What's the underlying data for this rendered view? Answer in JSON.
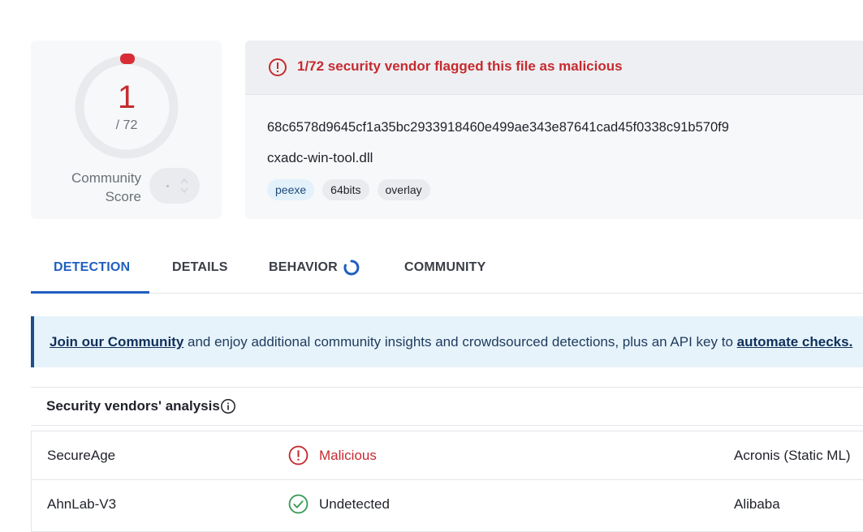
{
  "score": {
    "detections": "1",
    "total": "/ 72",
    "label": "Community Score"
  },
  "summary": {
    "alert": "1/72 security vendor flagged this file as malicious",
    "hash": "68c6578d9645cf1a35bc2933918460e499ae343e87641cad45f0338c91b570f9",
    "filename": "cxadc-win-tool.dll",
    "tags": [
      "peexe",
      "64bits",
      "overlay"
    ]
  },
  "tabs": {
    "detection": "DETECTION",
    "details": "DETAILS",
    "behavior": "BEHAVIOR",
    "community": "COMMUNITY"
  },
  "banner": {
    "join_link": "Join our Community",
    "middle": " and enjoy additional community insights and crowdsourced detections, plus an API key to ",
    "automate_link": "automate checks."
  },
  "vendors": {
    "title": "Security vendors' analysis",
    "rows": [
      {
        "vendor": "SecureAge",
        "result": "Malicious",
        "result_icon": "alert-circle-icon",
        "next_vendor": "Acronis (Static ML)"
      },
      {
        "vendor": "AhnLab-V3",
        "result": "Undetected",
        "result_icon": "check-circle-icon",
        "next_vendor": "Alibaba"
      }
    ]
  },
  "colors": {
    "malicious": "#c52b2f",
    "undetected": "#3a9b54",
    "accent": "#1f5fbf",
    "banner_bg": "#e6f3fb"
  }
}
